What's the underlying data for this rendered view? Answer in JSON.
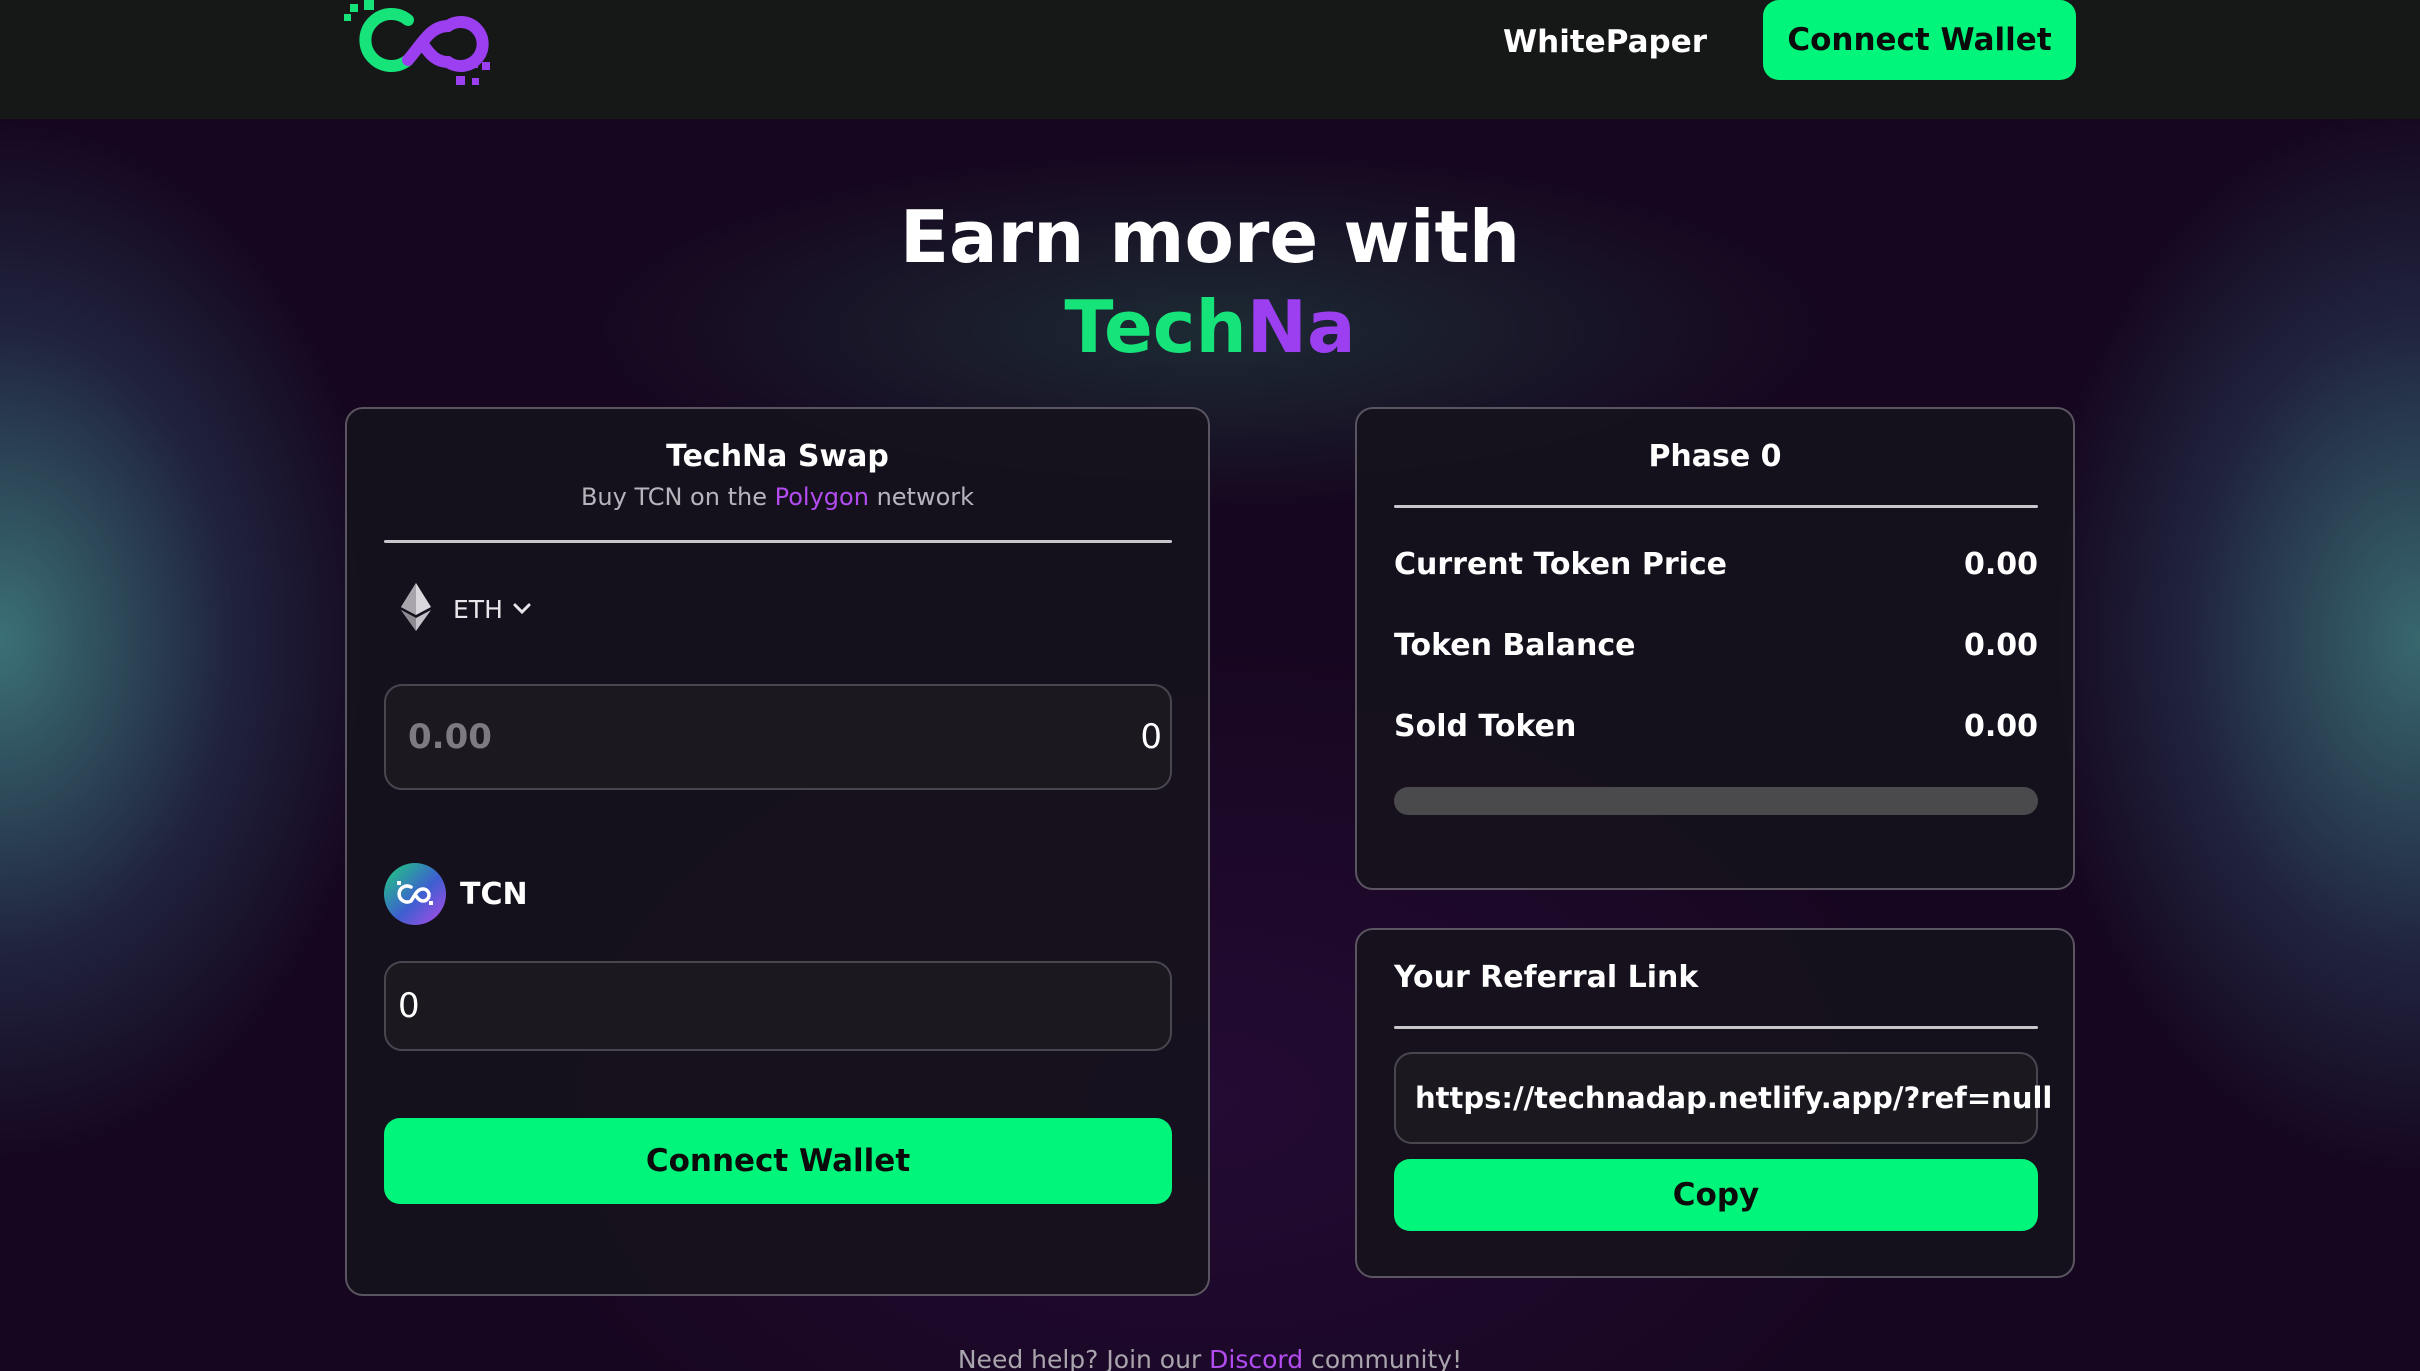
{
  "nav": {
    "whitepaper_label": "WhitePaper",
    "connect_label": "Connect Wallet"
  },
  "hero": {
    "line1": "Earn more with",
    "brand_part1": "Tech",
    "brand_part2": "Na"
  },
  "swap": {
    "title": "TechNa Swap",
    "subtitle_prefix": "Buy TCN on the",
    "network": "Polygon",
    "subtitle_suffix": "network",
    "pay_currency": "ETH",
    "pay_placeholder": "0.00",
    "pay_value": "0",
    "receive_token": "TCN",
    "receive_value": "0",
    "connect_label": "Connect Wallet"
  },
  "phase": {
    "title": "Phase 0",
    "stats": [
      {
        "label": "Current Token Price",
        "value": "0.00"
      },
      {
        "label": "Token Balance",
        "value": "0.00"
      },
      {
        "label": "Sold Token",
        "value": "0.00"
      }
    ],
    "progress_fraction": 0
  },
  "referral": {
    "title": "Your Referral Link",
    "link": "https://technadap.netlify.app/?ref=null",
    "copy_label": "Copy"
  },
  "footer": {
    "prefix": "Need help? Join our",
    "link": "Discord",
    "suffix": "community!"
  },
  "colors": {
    "accent_green": "#00f57a",
    "brand_purple": "#9b3ff0",
    "link_purple": "#b24cf0"
  },
  "icons": {
    "logo": "techna-logo",
    "eth": "ethereum-icon",
    "chevron": "chevron-down-icon",
    "tcn": "tcn-token-icon"
  }
}
